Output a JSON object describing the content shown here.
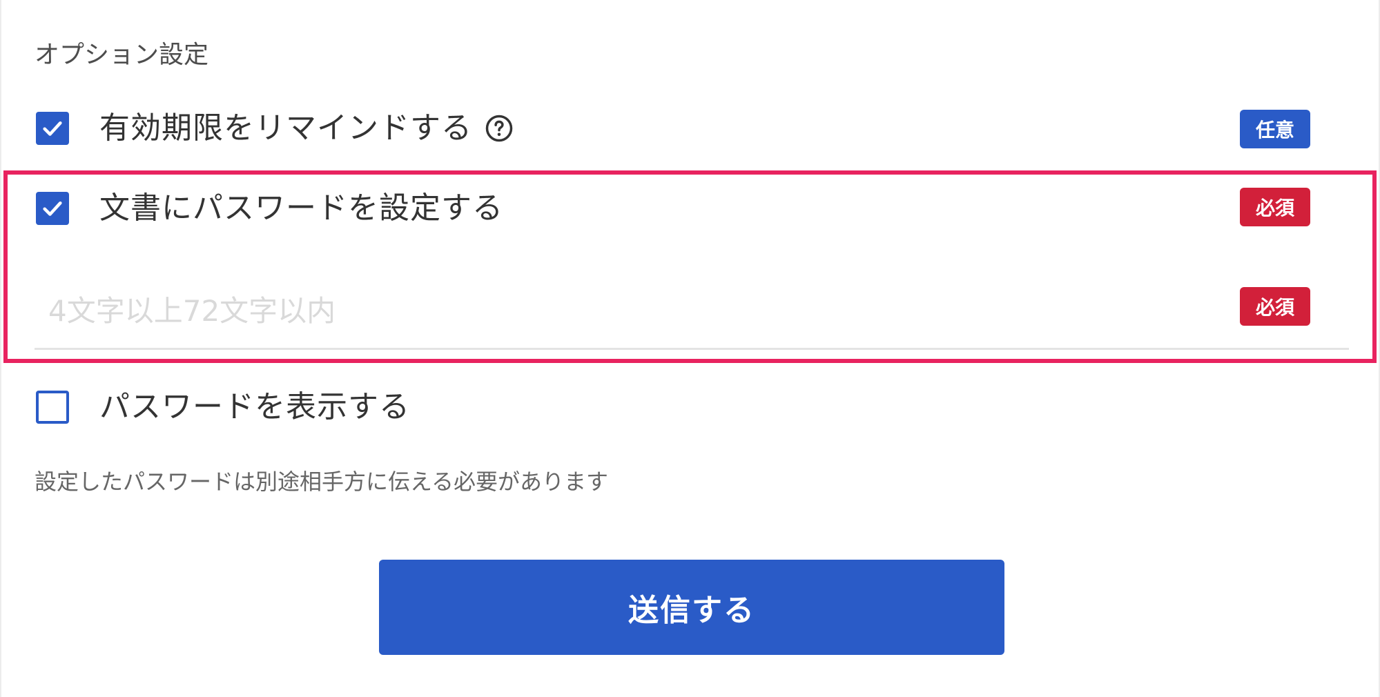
{
  "section": {
    "title": "オプション設定"
  },
  "options": {
    "remind": {
      "label": "有効期限をリマインドする",
      "checked": true,
      "badge": "任意",
      "help_icon": "question-circle-icon"
    },
    "set_password": {
      "label": "文書にパスワードを設定する",
      "checked": true,
      "badge": "必須"
    },
    "show_password": {
      "label": "パスワードを表示する",
      "checked": false
    }
  },
  "password_field": {
    "value": "",
    "placeholder": "4文字以上72文字以内",
    "badge": "必須"
  },
  "note": "設定したパスワードは別途相手方に伝える必要があります",
  "submit": {
    "label": "送信する"
  },
  "colors": {
    "primary": "#2a5bc7",
    "required": "#d2203a",
    "highlight": "#e8235f"
  }
}
